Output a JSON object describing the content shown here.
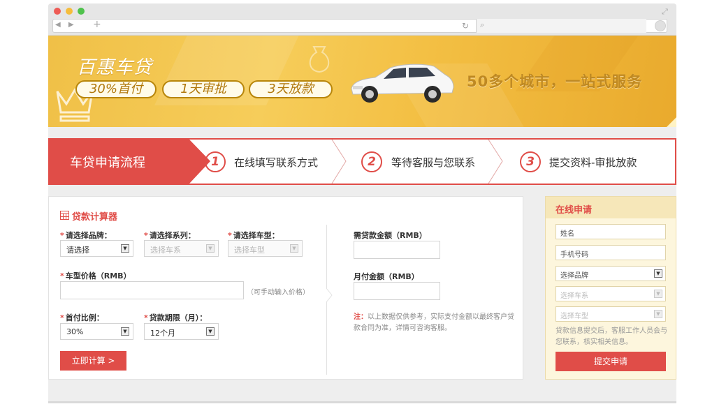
{
  "browser": {
    "nav_glyphs": "◀ ▶",
    "new_tab_glyph": "+",
    "reload_glyph": "↻",
    "search_glyph": "⌕",
    "resize_glyph": "⤢"
  },
  "banner": {
    "brand": "百惠车贷",
    "pills": [
      "30%首付",
      "1天审批",
      "3天放款"
    ],
    "slogan": "50多个城市，一站式服务"
  },
  "steps": {
    "title": "车贷申请流程",
    "items": [
      {
        "num": "1",
        "label": "在线填写联系方式"
      },
      {
        "num": "2",
        "label": "等待客服与您联系"
      },
      {
        "num": "3",
        "label": "提交资料-审批放款"
      }
    ]
  },
  "calculator": {
    "title": "贷款计算器",
    "required_mark": "*",
    "brand_label": "请选择品牌：",
    "brand_value": "请选择",
    "series_label": "请选择系列：",
    "series_value": "选择车系",
    "model_label": "请选择车型：",
    "model_value": "选择车型",
    "price_label": "车型价格（RMB）",
    "price_hint": "（可手动输入价格）",
    "down_label": "首付比例：",
    "down_value": "30%",
    "term_label": "贷款期限（月）：",
    "term_value": "12个月",
    "calc_button": "立即计算 >",
    "loan_label": "需贷款金额（RMB）",
    "monthly_label": "月付金额（RMB）",
    "note_prefix": "注：",
    "note_text": "以上数据仅供参考，实际支付金额以最终客户贷款合同为准，详情可咨询客服。"
  },
  "apply": {
    "title": "在线申请",
    "name_placeholder": "姓名",
    "phone_placeholder": "手机号码",
    "brand_value": "选择品牌",
    "series_value": "选择车系",
    "model_value": "选择车型",
    "note": "贷款信息提交后，客服工作人员会与您联系，核实相关信息。",
    "submit": "提交申请"
  },
  "colors": {
    "accent": "#e04d48",
    "banner": "#f3bf43",
    "slogan": "#bf8922",
    "apply_bg": "#fdf6dd"
  }
}
